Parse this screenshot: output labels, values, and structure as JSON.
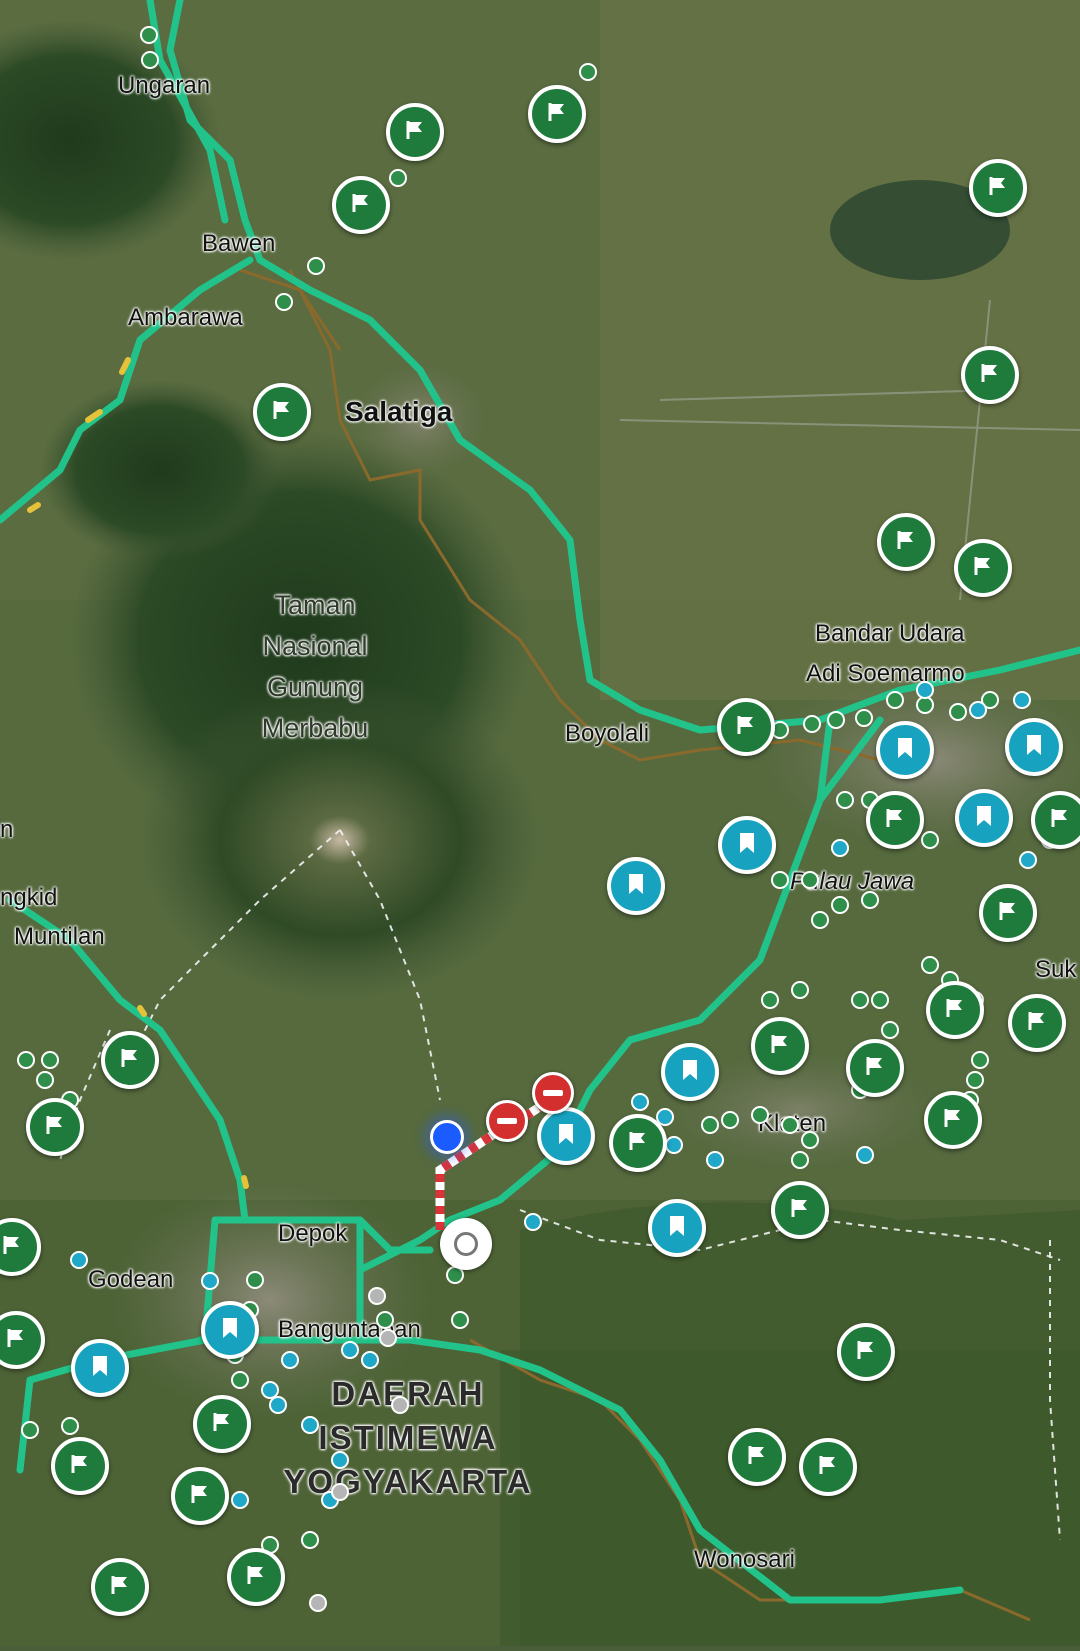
{
  "places": {
    "ungaran": "Ungaran",
    "bawen": "Bawen",
    "ambarawa": "Ambarawa",
    "salatiga": "Salatiga",
    "park_line1": "Taman",
    "park_line2": "Nasional",
    "park_line3": "Gunung",
    "park_line4": "Merbabu",
    "airport_line1": "Bandar Udara",
    "airport_line2": "Adi Soemarmo",
    "boyolali": "Boyolali",
    "pulau_jawa": "Pulau Jawa",
    "mungkid": "ngkid",
    "muntilan": "Muntilan",
    "edge_n": "n",
    "suk": "Suk",
    "klaten": "Klaten",
    "depok": "Depok",
    "godean": "Godean",
    "banguntapan": "Banguntapan",
    "region_line1": "DAERAH",
    "region_line2": "ISTIMEWA",
    "region_line3": "YOGYAKARTA",
    "wonosari": "Wonosari"
  },
  "markers": {
    "saved_place_icon": "flag-icon",
    "bookmark_icon": "bookmark-icon",
    "road_closure_icon": "no-entry-icon",
    "location_icon": "my-location-dot",
    "colors": {
      "saved_place": "#1e7b3c",
      "bookmark": "#17a2c0",
      "road": "#22c38a",
      "closure": "#d32f2f",
      "my_location": "#1a5cff"
    }
  }
}
